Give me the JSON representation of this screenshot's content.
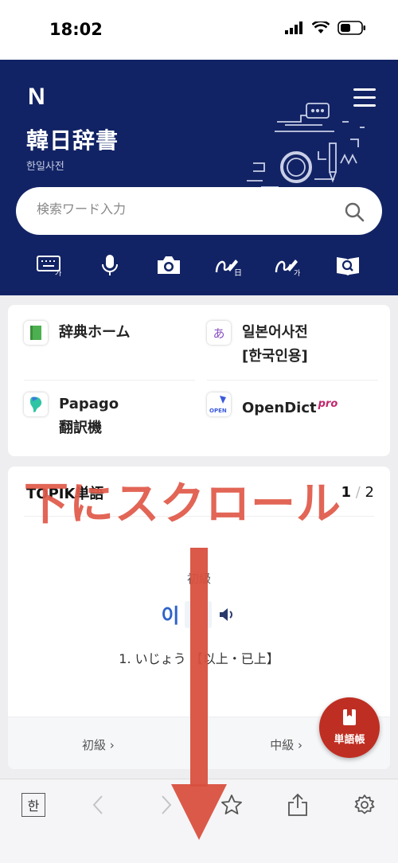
{
  "status_bar": {
    "time": "18:02"
  },
  "header": {
    "logo": "N",
    "title": "韓日辞書",
    "subtitle": "한일사전"
  },
  "search": {
    "placeholder": "検索ワード入力"
  },
  "tools": [
    "keyboard-icon",
    "microphone-icon",
    "camera-icon",
    "handwriting-japanese-icon",
    "handwriting-korean-icon",
    "dictionary-search-icon"
  ],
  "quick_links": [
    {
      "label": "辞典ホーム",
      "icon": "book-icon"
    },
    {
      "label_line1": "일본어사전",
      "label_line2": "[한국인용]",
      "icon": "hiragana-a-icon",
      "glyph": "あ"
    },
    {
      "label_line1": "Papago",
      "label_line2": "翻訳機",
      "icon": "papago-icon"
    },
    {
      "label": "OpenDict",
      "badge": "pro",
      "icon": "opendict-icon",
      "glyph": "OPEN"
    }
  ],
  "topik": {
    "title": "TOPIK単語",
    "page_current": "1",
    "page_sep": "/",
    "page_total": "2",
    "level": "初級",
    "word": "이",
    "meaning": "1. いじょう 【以上・已上】",
    "prev_label": "初級 ›",
    "next_label": "中級 ›"
  },
  "fab": {
    "label": "単語帳"
  },
  "bottom_bar": {
    "han": "한"
  },
  "overlay": {
    "text": "下にスクロール"
  },
  "colors": {
    "header_bg": "#122365",
    "accent_red": "#bf2e22",
    "word_blue": "#2f63c9",
    "overlay_red": "#e05a4a"
  }
}
